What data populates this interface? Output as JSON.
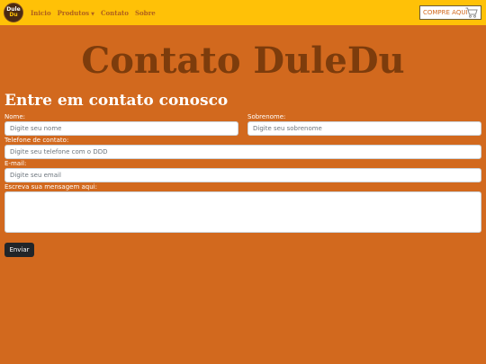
{
  "navbar": {
    "logo": {
      "line1": "Dule",
      "line2": "Du"
    },
    "links": [
      {
        "label": "Inicio"
      },
      {
        "label": "Produtos",
        "dropdown": true
      },
      {
        "label": "Contato"
      },
      {
        "label": "Sobre"
      }
    ],
    "buy_button": {
      "label": "COMPRE AQUI",
      "icon": "cart-icon"
    }
  },
  "page": {
    "title": "Contato DuleDu",
    "section_title": "Entre em contato conosco"
  },
  "form": {
    "nome": {
      "label": "Nome:",
      "placeholder": "Digite seu nome"
    },
    "sobrenome": {
      "label": "Sobrenome:",
      "placeholder": "Digite seu sobrenome"
    },
    "telefone": {
      "label": "Telefone de contato:",
      "placeholder": "Digite seu telefone com o DDD"
    },
    "email": {
      "label": "E-mail:",
      "placeholder": "Digite seu email"
    },
    "mensagem": {
      "label": "Escreva sua mensagem aqui:",
      "placeholder": ""
    },
    "submit_label": "Enviar"
  },
  "colors": {
    "background": "#d2691e",
    "navbar": "#ffc107",
    "title": "#7d3c0c",
    "button": "#212529"
  }
}
